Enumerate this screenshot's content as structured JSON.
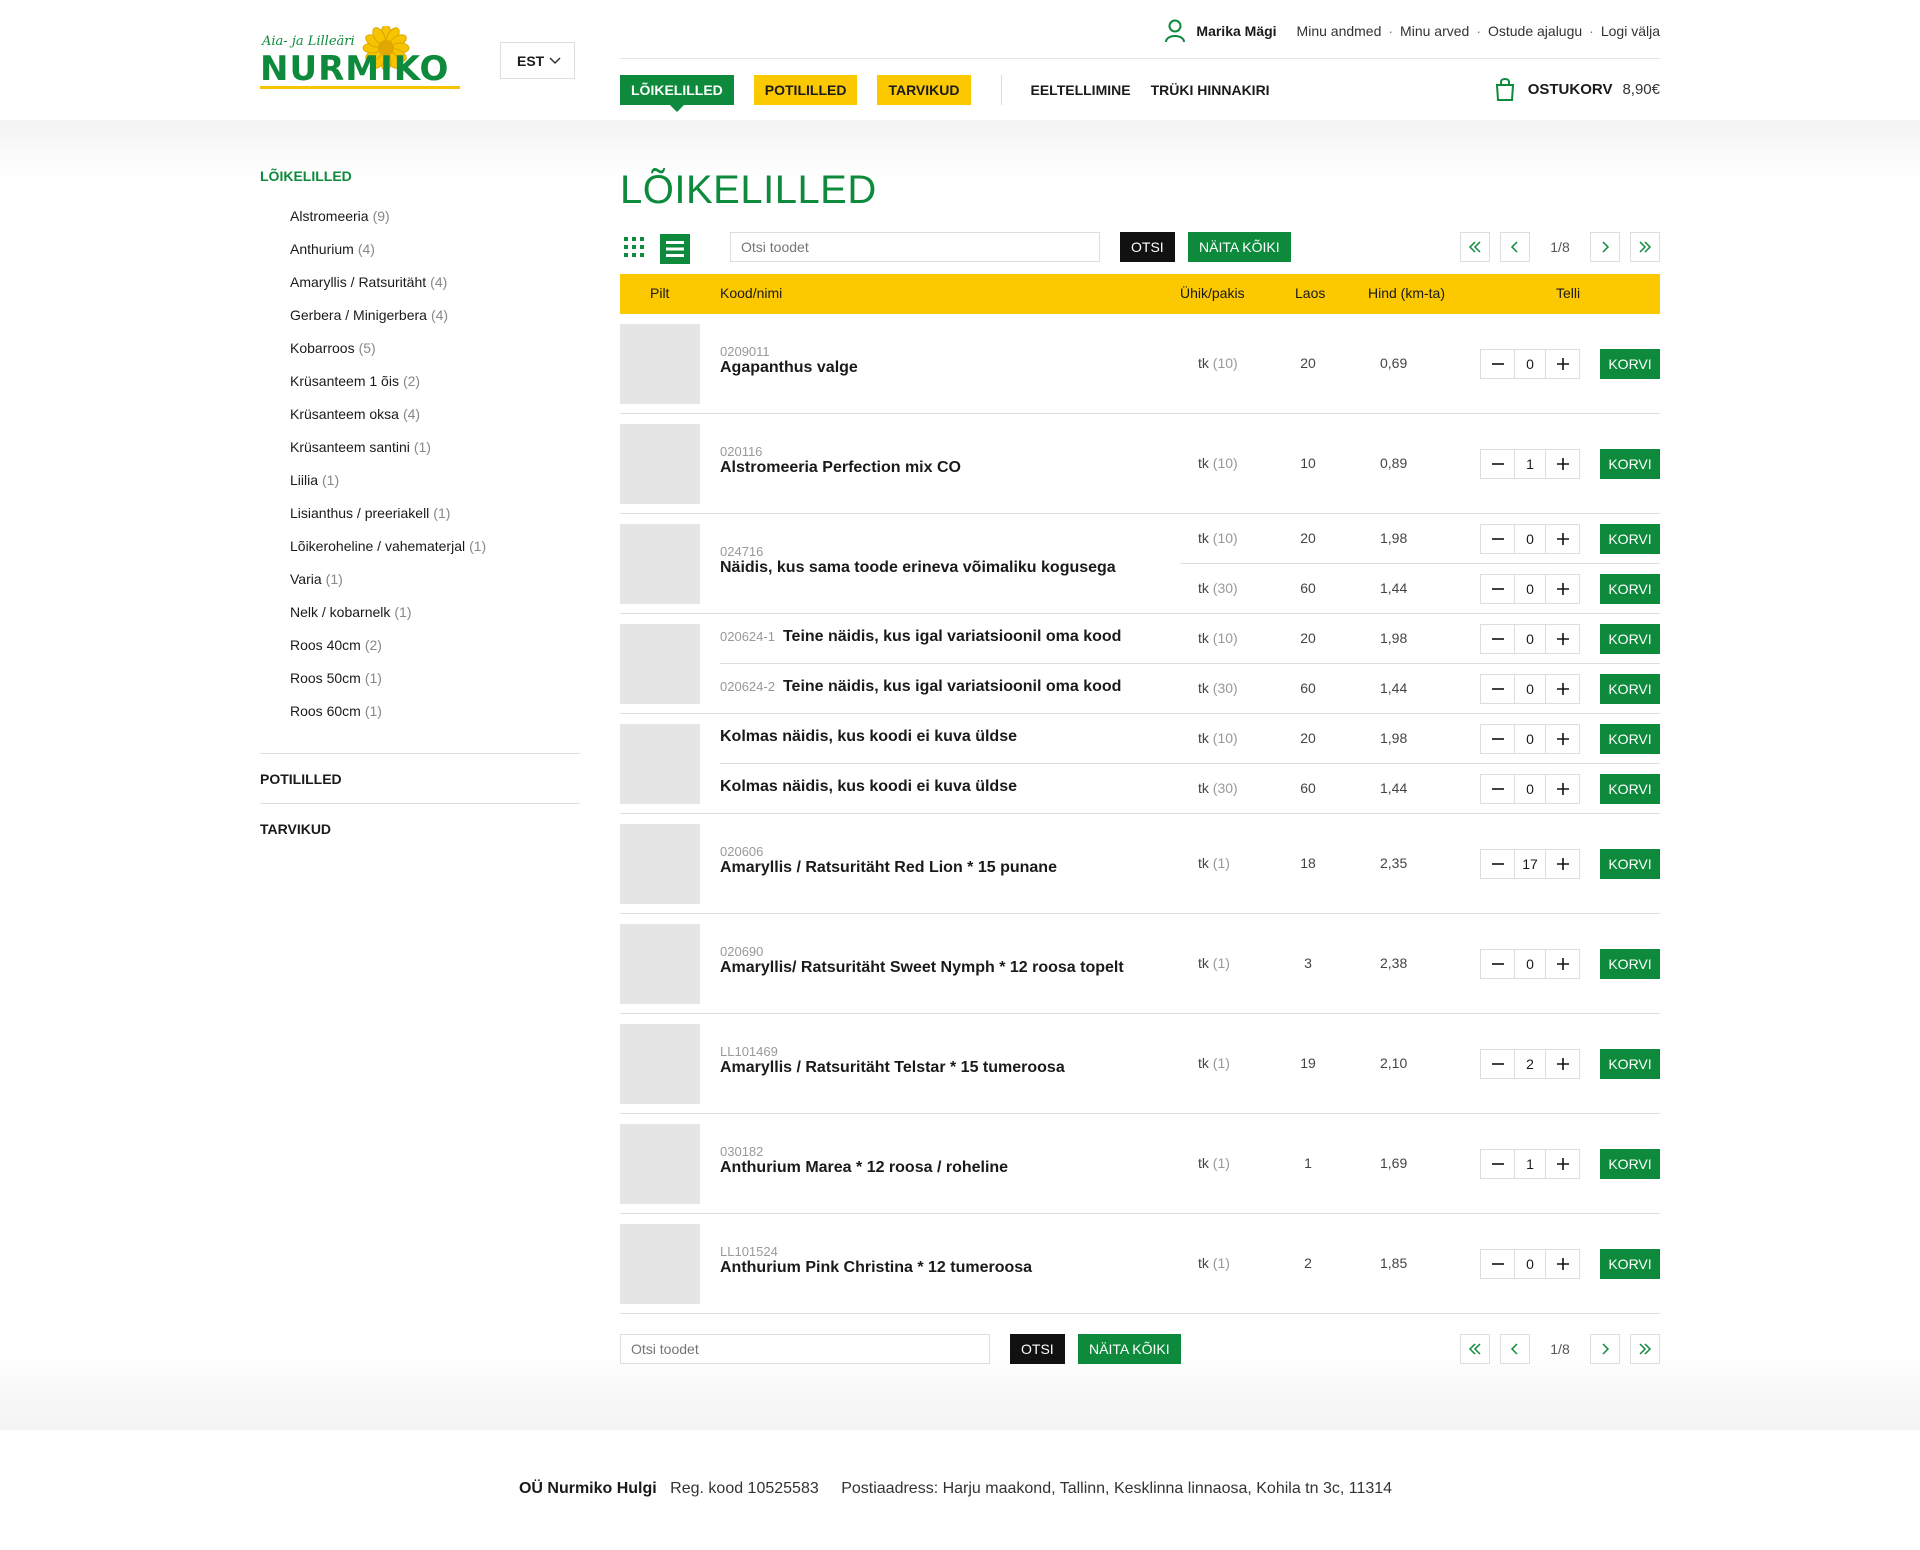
{
  "logo": {
    "script_text": "Aia- ja Lilleäri",
    "brand": "NURMIKO"
  },
  "lang": {
    "selected": "EST"
  },
  "user": {
    "name": "Marika Mägi",
    "links": [
      "Minu andmed",
      "Minu arved",
      "Ostude ajalugu",
      "Logi välja"
    ]
  },
  "nav": {
    "categories": [
      "LÕIKELILLED",
      "POTILILLED",
      "TARVIKUD"
    ],
    "links": [
      "EELTELLIMINE",
      "TRÜKI HINNAKIRI"
    ],
    "cart_label": "OSTUKORV",
    "cart_sum": "8,90€"
  },
  "sidebar": {
    "heading": "LÕIKELILLED",
    "items": [
      {
        "label": "Alstromeeria",
        "count": "(9)"
      },
      {
        "label": "Anthurium",
        "count": "(4)"
      },
      {
        "label": "Amaryllis / Ratsuritäht",
        "count": "(4)"
      },
      {
        "label": "Gerbera / Minigerbera",
        "count": "(4)"
      },
      {
        "label": "Kobarroos",
        "count": "(5)"
      },
      {
        "label": "Krüsanteem 1 õis",
        "count": "(2)"
      },
      {
        "label": "Krüsanteem oksa",
        "count": "(4)"
      },
      {
        "label": "Krüsanteem santini",
        "count": "(1)"
      },
      {
        "label": "Liilia",
        "count": "(1)"
      },
      {
        "label": "Lisianthus / preeriakell",
        "count": "(1)"
      },
      {
        "label": "Lõikeroheline / vahematerjal",
        "count": "(1)"
      },
      {
        "label": "Varia",
        "count": "(1)"
      },
      {
        "label": "Nelk / kobarnelk",
        "count": "(1)"
      },
      {
        "label": "Roos 40cm",
        "count": "(2)"
      },
      {
        "label": "Roos 50cm",
        "count": "(1)"
      },
      {
        "label": "Roos 60cm",
        "count": "(1)"
      }
    ],
    "sections": [
      "POTILILLED",
      "TARVIKUD"
    ]
  },
  "main": {
    "title": "LÕIKELILLED",
    "search_placeholder": "Otsi toodet",
    "search_button": "OTSI",
    "show_all_button": "NÄITA KÕIKI",
    "page": "1/8",
    "columns": {
      "image": "Pilt",
      "code_name": "Kood/nimi",
      "unit": "Ühik/pakis",
      "stock": "Laos",
      "price": "Hind (km-ta)",
      "order": "Telli"
    },
    "add_button": "KORVI"
  },
  "products": [
    {
      "code": "0209011",
      "name": "Agapanthus valge",
      "unit": "tk",
      "pack": "(10)",
      "stock": "20",
      "price": "0,69",
      "qty": "0"
    },
    {
      "code": "020116",
      "name": "Alstromeeria Perfection mix CO",
      "unit": "tk",
      "pack": "(10)",
      "stock": "10",
      "price": "0,89",
      "qty": "1"
    },
    {
      "code": "024716",
      "name": "Näidis, kus sama toode erineva võimaliku kogusega",
      "variants": [
        {
          "unit": "tk",
          "pack": "(10)",
          "stock": "20",
          "price": "1,98",
          "qty": "0"
        },
        {
          "unit": "tk",
          "pack": "(30)",
          "stock": "60",
          "price": "1,44",
          "qty": "0"
        }
      ]
    },
    {
      "variants": [
        {
          "code": "020624-1",
          "name": "Teine näidis, kus igal variatsioonil oma kood",
          "unit": "tk",
          "pack": "(10)",
          "stock": "20",
          "price": "1,98",
          "qty": "0"
        },
        {
          "code": "020624-2",
          "name": "Teine näidis, kus igal variatsioonil oma kood",
          "unit": "tk",
          "pack": "(30)",
          "stock": "60",
          "price": "1,44",
          "qty": "0"
        }
      ]
    },
    {
      "variants": [
        {
          "name": "Kolmas näidis, kus koodi ei kuva üldse",
          "unit": "tk",
          "pack": "(10)",
          "stock": "20",
          "price": "1,98",
          "qty": "0"
        },
        {
          "name": "Kolmas näidis, kus koodi ei kuva üldse",
          "unit": "tk",
          "pack": "(30)",
          "stock": "60",
          "price": "1,44",
          "qty": "0"
        }
      ]
    },
    {
      "code": "020606",
      "name": "Amaryllis / Ratsuritäht Red Lion * 15 punane",
      "unit": "tk",
      "pack": "(1)",
      "stock": "18",
      "price": "2,35",
      "qty": "17"
    },
    {
      "code": "020690",
      "name": "Amaryllis/ Ratsuritäht Sweet Nymph * 12 roosa topelt",
      "unit": "tk",
      "pack": "(1)",
      "stock": "3",
      "price": "2,38",
      "qty": "0"
    },
    {
      "code": "LL101469",
      "name": "Amaryllis / Ratsuritäht Telstar * 15 tumeroosa",
      "unit": "tk",
      "pack": "(1)",
      "stock": "19",
      "price": "2,10",
      "qty": "2"
    },
    {
      "code": "030182",
      "name": "Anthurium Marea * 12 roosa / roheline",
      "unit": "tk",
      "pack": "(1)",
      "stock": "1",
      "price": "1,69",
      "qty": "1"
    },
    {
      "code": "LL101524",
      "name": "Anthurium Pink Christina * 12 tumeroosa",
      "unit": "tk",
      "pack": "(1)",
      "stock": "2",
      "price": "1,85",
      "qty": "0"
    }
  ],
  "footer": {
    "company": "OÜ Nurmiko Hulgi",
    "reg": "Reg. kood 10525583",
    "address": "Postiaadress: Harju maakond, Tallinn, Kesklinna linnaosa, Kohila tn 3c, 11314"
  },
  "colors": {
    "green": "#0d8a3c",
    "yellow": "#fcc800",
    "dark": "#111111"
  },
  "icons": [
    "user-icon",
    "chevron-down-icon",
    "cart-icon",
    "grid-view-icon",
    "list-view-icon",
    "first-page-icon",
    "prev-page-icon",
    "next-page-icon",
    "last-page-icon",
    "minus-icon",
    "plus-icon"
  ]
}
